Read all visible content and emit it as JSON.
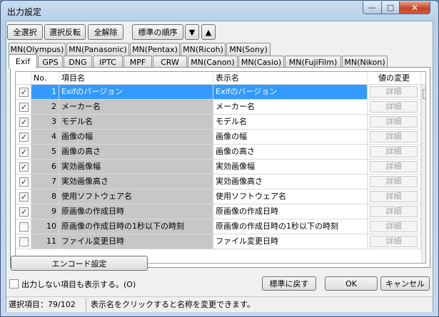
{
  "window": {
    "title": "出力設定",
    "min_glyph": "—",
    "max_glyph": "□",
    "close_glyph": "✕"
  },
  "toolbar": {
    "select_all": "全選択",
    "invert": "選択反転",
    "clear_all": "全解除",
    "default_order": "標準の順序",
    "move_down": "▼",
    "move_up": "▲"
  },
  "tabs_row1": [
    "MN(Olympus)",
    "MN(Panasonic)",
    "MN(Pentax)",
    "MN(Ricoh)",
    "MN(Sony)"
  ],
  "tabs_row2": [
    "Exif",
    "GPS",
    "DNG",
    "IPTC",
    "MPF",
    "CRW",
    "MN(Canon)",
    "MN(Casio)",
    "MN(FujiFilm)",
    "MN(Nikon)"
  ],
  "active_tab": "Exif",
  "grid": {
    "headers": {
      "no": "No.",
      "item": "項目名",
      "display": "表示名",
      "change": "値の変更"
    },
    "detail_label": "詳細",
    "rows": [
      {
        "checked": true,
        "no": "1",
        "item": "Exifのバージョン",
        "display": "Exifのバージョン",
        "selected": true
      },
      {
        "checked": true,
        "no": "2",
        "item": "メーカー名",
        "display": "メーカー名"
      },
      {
        "checked": true,
        "no": "3",
        "item": "モデル名",
        "display": "モデル名"
      },
      {
        "checked": true,
        "no": "4",
        "item": "画像の幅",
        "display": "画像の幅"
      },
      {
        "checked": true,
        "no": "5",
        "item": "画像の高さ",
        "display": "画像の高さ"
      },
      {
        "checked": true,
        "no": "6",
        "item": "実効画像幅",
        "display": "実効画像幅"
      },
      {
        "checked": true,
        "no": "7",
        "item": "実効画像高さ",
        "display": "実効画像高さ"
      },
      {
        "checked": true,
        "no": "8",
        "item": "使用ソフトウェア名",
        "display": "使用ソフトウェア名"
      },
      {
        "checked": true,
        "no": "9",
        "item": "原画像の作成日時",
        "display": "原画像の作成日時"
      },
      {
        "checked": false,
        "no": "10",
        "item": "原画像の作成日時の1秒以下の時刻",
        "display": "原画像の作成日時の1秒以下の時刻"
      },
      {
        "checked": false,
        "no": "11",
        "item": "ファイル変更日時",
        "display": "ファイル変更日時"
      }
    ]
  },
  "encode_button": "エンコード設定",
  "show_hidden_label": "出力しない項目も表示する。(O)",
  "reset_button": "標準に戻す",
  "ok_button": "OK",
  "cancel_button": "キャンセル",
  "status": {
    "selected": "選択項目：79/102",
    "hint": "表示名をクリックすると名称を変更できます。"
  }
}
